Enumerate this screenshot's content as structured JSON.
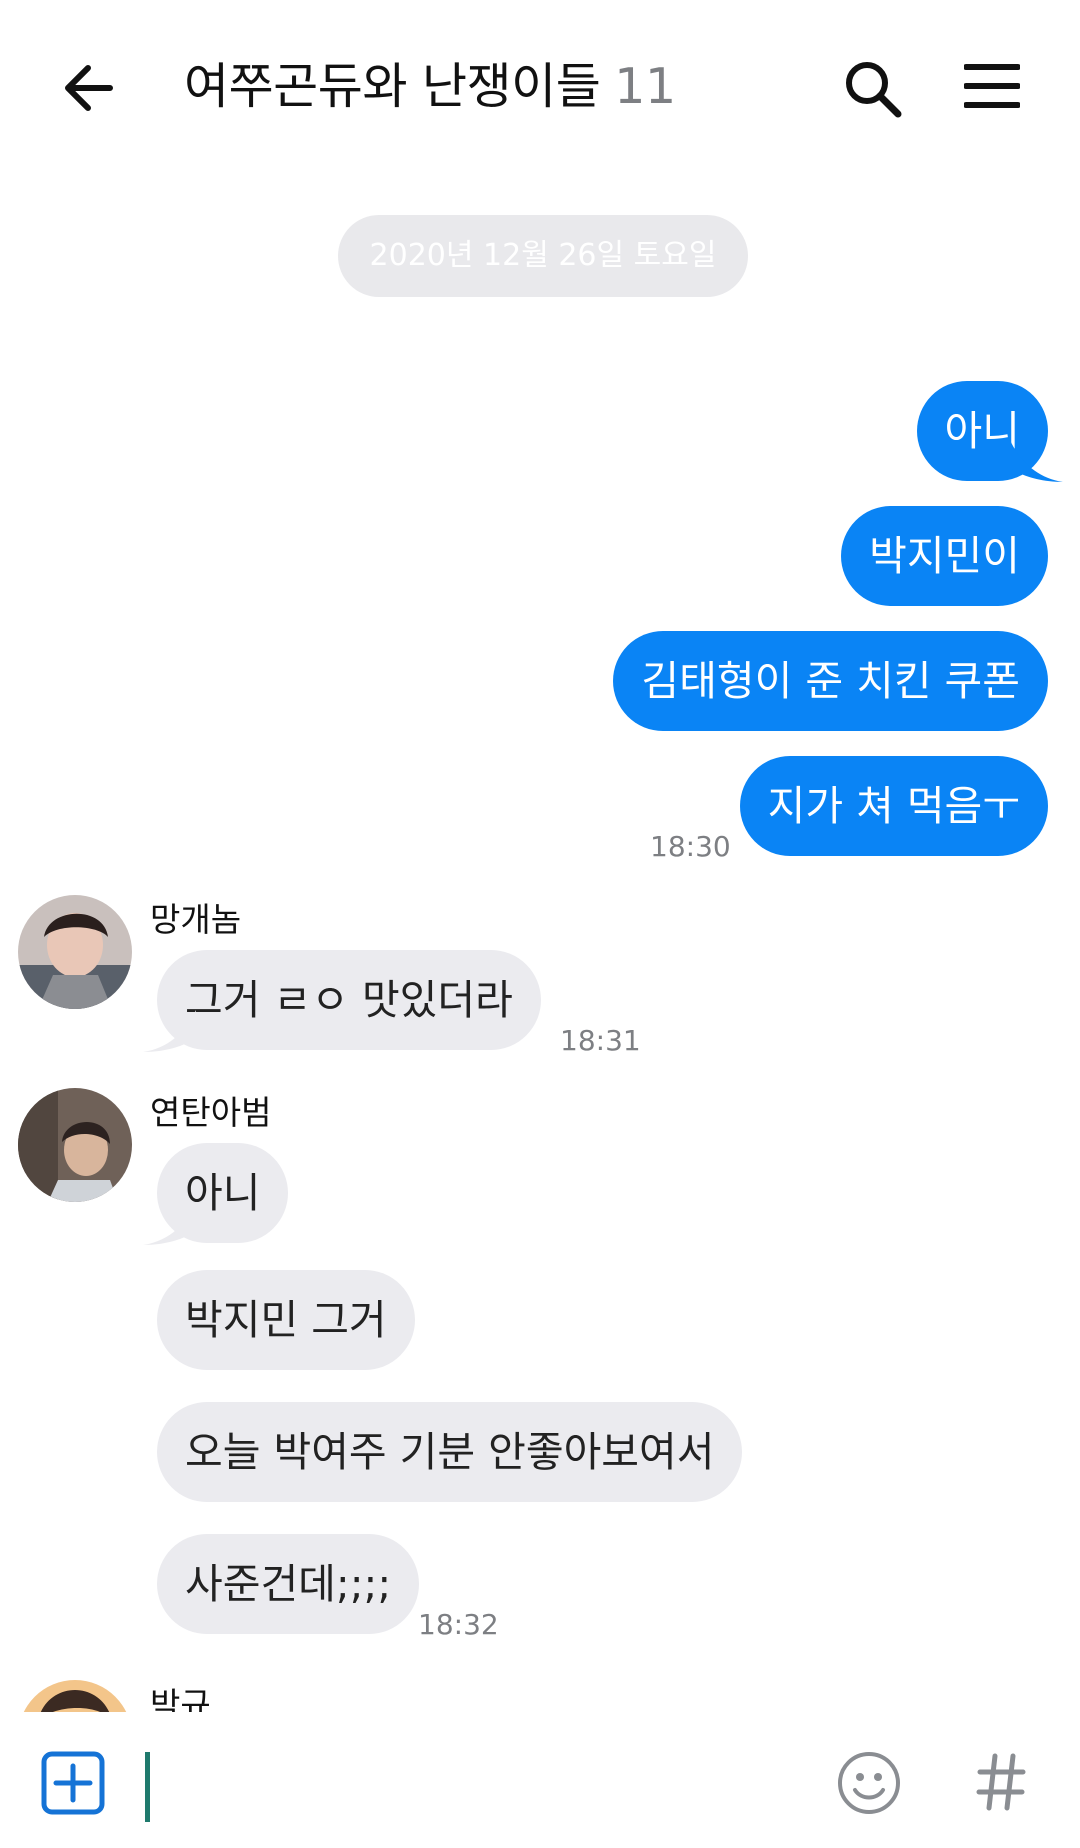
{
  "header": {
    "title": "여쭈곤듀와 난쟁이들",
    "member_count": "11"
  },
  "date_divider": "2020년 12월 26일 토요일",
  "outgoing": {
    "messages": [
      "아니",
      "박지민이",
      "김태형이 준 치킨 쿠폰",
      "지가 쳐 먹음ㅜ"
    ],
    "time": "18:30"
  },
  "group1": {
    "sender": "망개놈",
    "messages": [
      "그거 ㄹㅇ 맛있더라"
    ],
    "time": "18:31"
  },
  "group2": {
    "sender": "연탄아범",
    "messages": [
      "아니",
      "박지민 그거",
      "오늘 박여주 기분 안좋아보여서",
      "사준건데;;;;"
    ],
    "time": "18:32"
  },
  "group3": {
    "sender": "박규"
  },
  "icons": {
    "back": "back-arrow-icon",
    "search": "search-icon",
    "menu": "menu-icon",
    "add": "plus-box-icon",
    "emoji": "smiley-icon",
    "hashtag": "hashtag-icon"
  },
  "colors": {
    "outgoing_bubble": "#0a84f5",
    "incoming_bubble": "#ebebef",
    "accent_cursor": "#1f7a6d"
  }
}
